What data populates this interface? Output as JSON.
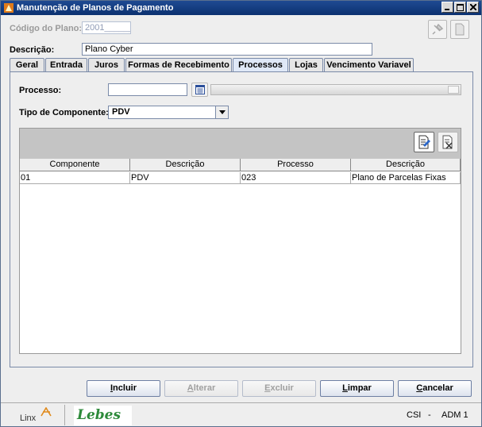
{
  "window": {
    "title": "Manutenção de Planos de Pagamento",
    "icon": "orange-app-icon"
  },
  "form": {
    "codigo_label": "Código do Plano:",
    "codigo_value": "2001______",
    "descricao_label": "Descrição:",
    "descricao_value": "Plano Cyber"
  },
  "tabs": [
    {
      "label": "Geral"
    },
    {
      "label": "Entrada"
    },
    {
      "label": "Juros"
    },
    {
      "label": "Formas de Recebimento"
    },
    {
      "label": "Processos",
      "selected": true
    },
    {
      "label": "Lojas"
    },
    {
      "label": "Vencimento Variavel"
    }
  ],
  "processos": {
    "processo_label": "Processo:",
    "processo_value": "",
    "tipo_label": "Tipo de Componente:",
    "tipo_value": "PDV"
  },
  "grid": {
    "columns": [
      "Componente",
      "Descrição",
      "Processo",
      "Descrição"
    ],
    "rows": [
      [
        "01",
        "PDV",
        "023",
        "Plano de Parcelas Fixas"
      ]
    ]
  },
  "buttons": {
    "incluir": {
      "first": "I",
      "rest": "ncluir"
    },
    "alterar": {
      "first": "A",
      "rest": "lterar"
    },
    "excluir": {
      "first": "E",
      "rest": "xcluir"
    },
    "limpar": {
      "first": "L",
      "rest": "impar"
    },
    "cancelar": {
      "first": "C",
      "rest": "ancelar"
    }
  },
  "status": {
    "linx": "Linx",
    "lebes": "Lebes",
    "system": "CSI",
    "dash": "-",
    "user": "ADM 1"
  }
}
